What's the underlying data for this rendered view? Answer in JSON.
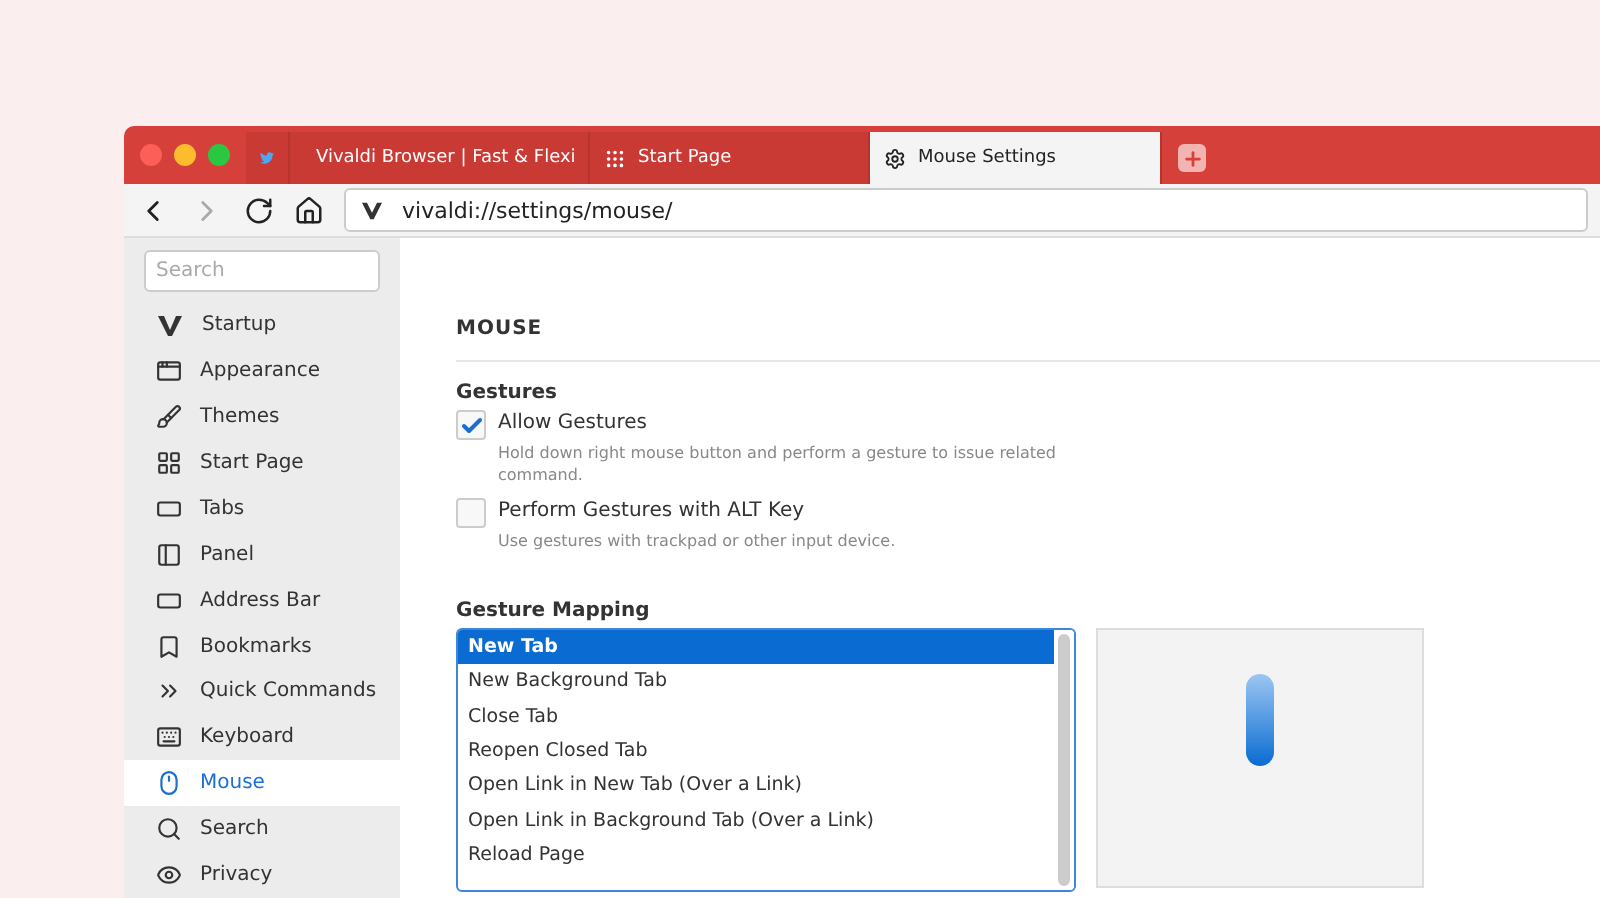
{
  "tabs": [
    {
      "kind": "bird",
      "selected": false
    },
    {
      "kind": "vivaldi",
      "label": "Vivaldi Browser | Fast & Flexi",
      "selected": false
    },
    {
      "kind": "grid",
      "label": "Start Page",
      "selected": false
    },
    {
      "kind": "gear",
      "label": "Mouse Settings",
      "selected": true
    }
  ],
  "address": {
    "url": "vivaldi://settings/mouse/"
  },
  "sidebar": {
    "search": {
      "placeholder": "Search"
    },
    "items": [
      {
        "kind": "startup",
        "label": "Startup",
        "selected": false
      },
      {
        "kind": "appearance",
        "label": "Appearance",
        "selected": false
      },
      {
        "kind": "themes",
        "label": "Themes",
        "selected": false
      },
      {
        "kind": "startpage",
        "label": "Start Page",
        "selected": false
      },
      {
        "kind": "tabs",
        "label": "Tabs",
        "selected": false
      },
      {
        "kind": "panel",
        "label": "Panel",
        "selected": false
      },
      {
        "kind": "addressbar",
        "label": "Address Bar",
        "selected": false
      },
      {
        "kind": "bookmarks",
        "label": "Bookmarks",
        "selected": false
      },
      {
        "kind": "commands",
        "label": "Quick Commands",
        "selected": false
      },
      {
        "kind": "keyboard",
        "label": "Keyboard",
        "selected": false
      },
      {
        "kind": "mouse",
        "label": "Mouse",
        "selected": true
      },
      {
        "kind": "search",
        "label": "Search",
        "selected": false
      },
      {
        "kind": "privacy",
        "label": "Privacy",
        "selected": false
      }
    ]
  },
  "content": {
    "title": "MOUSE",
    "gestures": {
      "heading": "Gestures",
      "options": [
        {
          "label": "Allow Gestures",
          "checked": true,
          "hint": "Hold down right mouse button and perform a gesture to issue related command."
        },
        {
          "label": "Perform Gestures with ALT Key",
          "checked": false,
          "hint": "Use gestures with trackpad or other input device."
        }
      ]
    },
    "mapping": {
      "heading": "Gesture Mapping",
      "items": [
        {
          "label": "New Tab",
          "selected": true
        },
        {
          "label": "New Background Tab",
          "selected": false
        },
        {
          "label": "Close Tab",
          "selected": false
        },
        {
          "label": "Reopen Closed Tab",
          "selected": false
        },
        {
          "label": "Open Link in New Tab (Over a Link)",
          "selected": false
        },
        {
          "label": "Open Link in Background Tab (Over a Link)",
          "selected": false
        },
        {
          "label": "Reload Page",
          "selected": false
        }
      ]
    }
  }
}
